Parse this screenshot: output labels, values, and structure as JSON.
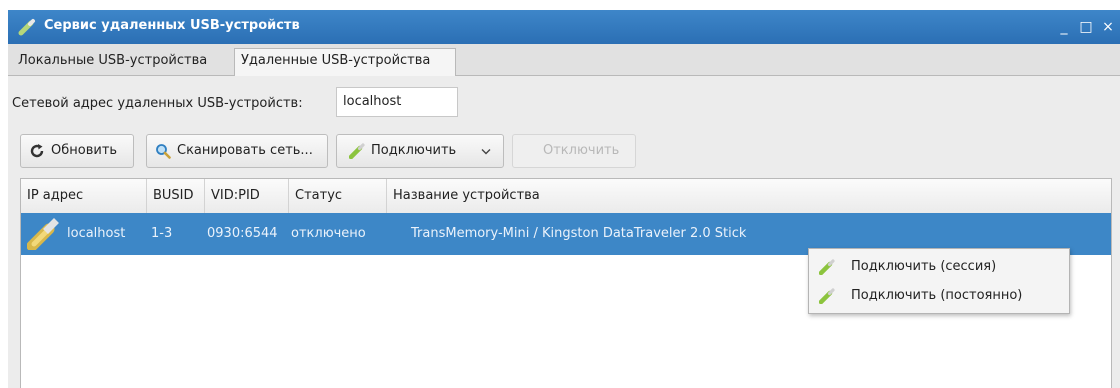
{
  "window": {
    "title": "Сервис удаленных USB-устройств",
    "controls": [
      "_",
      "□",
      "×"
    ]
  },
  "tabs": [
    {
      "label": "Локальные USB-устройства",
      "active": false
    },
    {
      "label": "Удаленные USB-устройства",
      "active": true
    }
  ],
  "address": {
    "label": "Сетевой адрес удаленных USB-устройств:",
    "value": "localhost"
  },
  "toolbar": {
    "refresh_label": "Обновить",
    "scan_label": "Сканировать сеть...",
    "connect_label": "Подключить",
    "disconnect_label": "Отключить"
  },
  "table": {
    "columns": [
      "IP адрес",
      "BUSID",
      "VID:PID",
      "Статус",
      "Название устройства"
    ],
    "rows": [
      {
        "ip": "localhost",
        "busid": "1-3",
        "vidpid": "0930:6544",
        "status": "отключено",
        "name": "TransMemory-Mini / Kingston DataTraveler 2.0 Stick",
        "selected": true
      }
    ]
  },
  "context_menu": {
    "items": [
      {
        "label": "Подключить (сессия)"
      },
      {
        "label": "Подключить (постоянно)"
      }
    ]
  },
  "colors": {
    "titlebar": "#2b6fb4",
    "selection": "#3d87c7",
    "usb_icon": "#7fb93a"
  },
  "icons": {
    "title": "usb-plug-icon",
    "refresh": "refresh-icon",
    "scan": "magnifier-icon",
    "connect": "usb-plug-icon",
    "row": "usb-stick-icon"
  }
}
